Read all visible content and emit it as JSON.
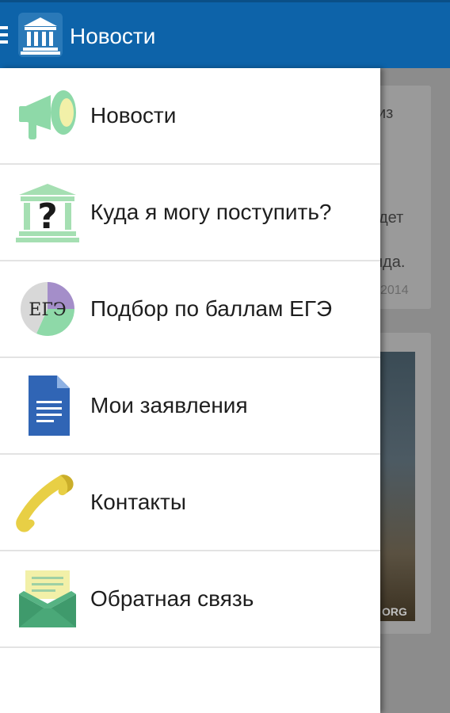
{
  "app_bar": {
    "title": "Новости",
    "background_color": "#0d63a9"
  },
  "menu": {
    "items": [
      {
        "label": "Новости",
        "icon": "megaphone-icon"
      },
      {
        "label": "Куда я могу поступить?",
        "icon": "university-question-icon"
      },
      {
        "label": "Подбор по баллам ЕГЭ",
        "icon": "ege-pie-icon",
        "icon_text": "ЕГЭ"
      },
      {
        "label": "Мои заявления",
        "icon": "document-icon"
      },
      {
        "label": "Контакты",
        "icon": "phone-icon"
      },
      {
        "label": "Обратная связь",
        "icon": "envelope-icon"
      }
    ]
  },
  "background": {
    "card1": {
      "text1": "из",
      "text2": "дет",
      "text3": "нда.",
      "date": "2014"
    },
    "card2": {
      "photo_caption": "ORG"
    }
  }
}
